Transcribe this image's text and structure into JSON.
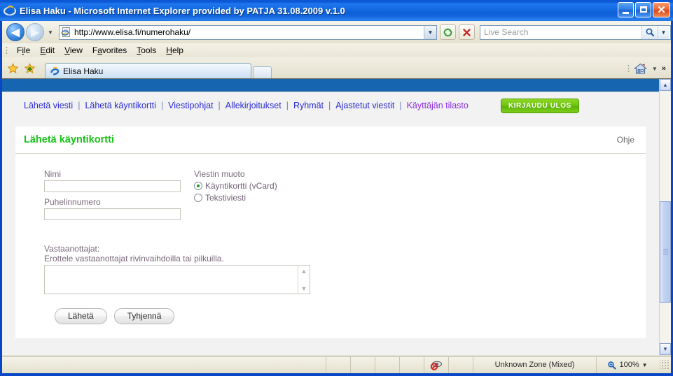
{
  "window": {
    "title": "Elisa Haku - Microsoft Internet Explorer provided by PATJA 31.08.2009 v.1.0",
    "icon": "ie-logo-icon",
    "minimize_label": "_",
    "maximize_label": "□",
    "close_label": "✕"
  },
  "address_bar": {
    "back_label": "◀",
    "forward_label": "▶",
    "history_dropdown_label": "▼",
    "url": "http://www.elisa.fi/numerohaku/",
    "url_dropdown_label": "▼",
    "refresh_label": "⟳",
    "stop_label": "✕",
    "search_placeholder": "Live Search",
    "search_go_label": "🔍",
    "search_dropdown_label": "▼"
  },
  "menu_bar": {
    "items": [
      {
        "pre": "F",
        "key": "i",
        "post": "le"
      },
      {
        "pre": "",
        "key": "E",
        "post": "dit"
      },
      {
        "pre": "",
        "key": "V",
        "post": "iew"
      },
      {
        "pre": "F",
        "key": "a",
        "post": "vorites"
      },
      {
        "pre": "",
        "key": "T",
        "post": "ools"
      },
      {
        "pre": "",
        "key": "H",
        "post": "elp"
      }
    ]
  },
  "tab_bar": {
    "favorites_icon": "star-icon",
    "add_favorite_icon": "star-plus-icon",
    "tab_label": "Elisa Haku",
    "tab_icon": "ie-page-icon",
    "new_tab_label": "",
    "home_icon": "home-icon",
    "home_dropdown_label": "▼",
    "overflow_label": "»"
  },
  "page": {
    "nav": {
      "links": [
        {
          "label": "Lähetä viesti",
          "visited": false
        },
        {
          "label": "Lähetä käyntikortti",
          "visited": false
        },
        {
          "label": "Viestipohjat",
          "visited": false
        },
        {
          "label": "Allekirjoitukset",
          "visited": false
        },
        {
          "label": "Ryhmät",
          "visited": false
        },
        {
          "label": "Ajastetut viestit",
          "visited": false
        },
        {
          "label": "Käyttäjän tilasto",
          "visited": true
        }
      ],
      "separator": "|",
      "logout_label": "KIRJAUDU ULOS",
      "logout_color": "#6fc410"
    },
    "card": {
      "title": "Lähetä käyntikortti",
      "title_color": "#17c117",
      "help_label": "Ohje",
      "fields": {
        "name_label": "Nimi",
        "name_value": "",
        "phone_label": "Puhelinnumero",
        "phone_value": ""
      },
      "message_format": {
        "legend": "Viestin muoto",
        "options": [
          {
            "label": "Käyntikortti (vCard)",
            "selected": true
          },
          {
            "label": "Tekstiviesti",
            "selected": false
          }
        ]
      },
      "recipients": {
        "label": "Vastaanottajat:",
        "hint": "Erottele vastaanottajat rivinvaihdoilla tai pilkuilla.",
        "value": "",
        "scroll_up_label": "▲",
        "scroll_down_label": "▼"
      },
      "buttons": {
        "submit_label": "Lähetä",
        "clear_label": "Tyhjennä"
      }
    },
    "scrollbar": {
      "up_label": "▲",
      "down_label": "▼"
    }
  },
  "status_bar": {
    "popup_blocker_icon": "popup-blocked-icon",
    "zone_label": "Unknown Zone (Mixed)",
    "zoom_icon": "magnifier-icon",
    "zoom_label": "100%",
    "zoom_dropdown_label": "▼"
  }
}
